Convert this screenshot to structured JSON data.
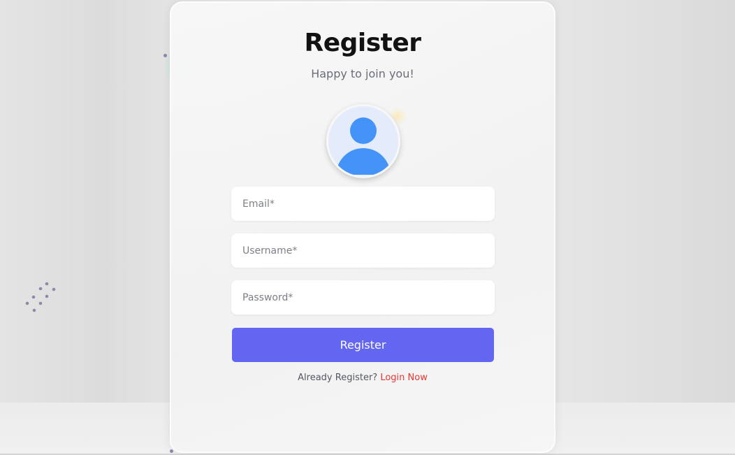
{
  "register": {
    "title": "Register",
    "subtitle": "Happy to join you!",
    "email_placeholder": "Email*",
    "username_placeholder": "Username*",
    "password_placeholder": "Password*",
    "submit_label": "Register",
    "already_text": "Already Register?",
    "login_link": "Login Now"
  },
  "icons": {
    "avatar": "user-avatar-icon"
  },
  "colors": {
    "accent": "#6366f1",
    "link": "#e53935",
    "avatar_fill": "#4393f8",
    "avatar_bg": "#e4ebfb"
  }
}
